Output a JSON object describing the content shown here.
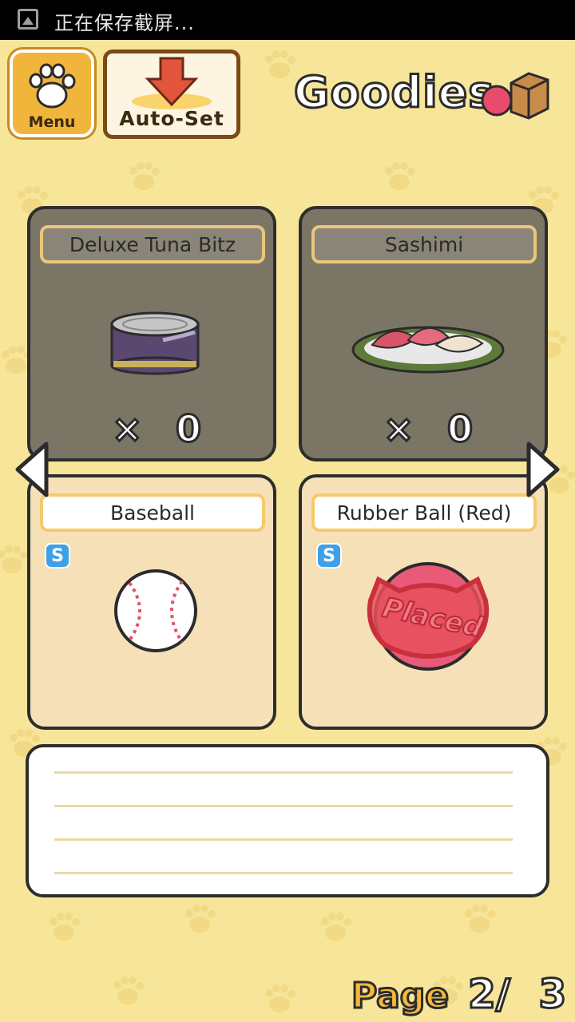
{
  "status_bar": {
    "text": "正在保存截屏..."
  },
  "header": {
    "menu_label": "Menu",
    "autoset_label": "Auto-Set",
    "title": "Goodies"
  },
  "items": [
    {
      "name": "Deluxe Tuna Bitz",
      "qty_x": "×",
      "qty": "0"
    },
    {
      "name": "Sashimi",
      "qty_x": "×",
      "qty": "0"
    },
    {
      "name": "Baseball",
      "badge": "S"
    },
    {
      "name": "Rubber Ball (Red)",
      "badge": "S",
      "overlay": "Placed"
    }
  ],
  "pagination": {
    "label": "Page",
    "current": "2/",
    "total": "3"
  },
  "colors": {
    "accent": "#f2b53b",
    "dark_card": "#7b7565",
    "light_card": "#f6e0b8",
    "placed": "#e24a5c"
  }
}
